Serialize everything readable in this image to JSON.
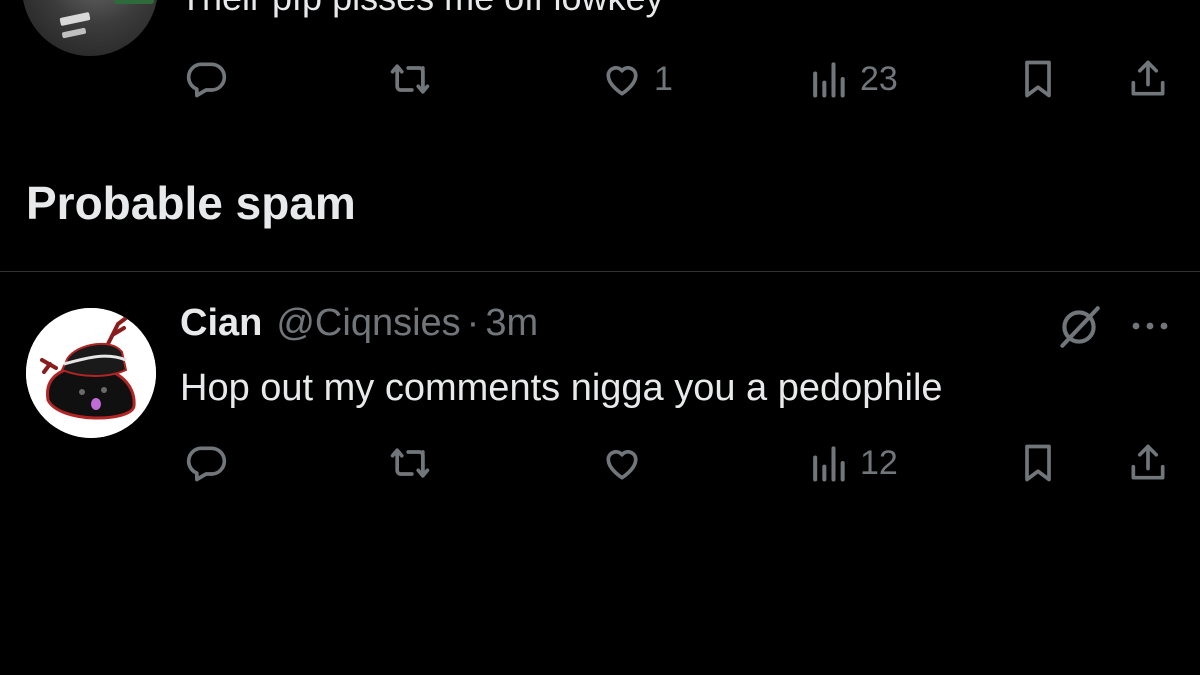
{
  "top_tweet": {
    "text": "Their pfp pisses me off lowkey",
    "actions": {
      "reply": "",
      "retweet": "",
      "like": "1",
      "views": "23"
    }
  },
  "section": {
    "title": "Probable spam"
  },
  "tweet": {
    "name": "Cian",
    "handle": "@Ciqnsies",
    "separator": "·",
    "time": "3m",
    "text": "Hop out my comments nigga you a pedophile",
    "actions": {
      "reply": "",
      "retweet": "",
      "like": "",
      "views": "12"
    }
  },
  "icons": {
    "reply": "reply-icon",
    "retweet": "retweet-icon",
    "like": "heart-icon",
    "views": "views-icon",
    "bookmark": "bookmark-icon",
    "share": "share-icon",
    "grok": "grok-icon",
    "more": "more-icon"
  },
  "colors": {
    "background": "#000000",
    "primary_text": "#e7e9ea",
    "secondary_text": "#71767b",
    "divider": "#2f3336"
  }
}
